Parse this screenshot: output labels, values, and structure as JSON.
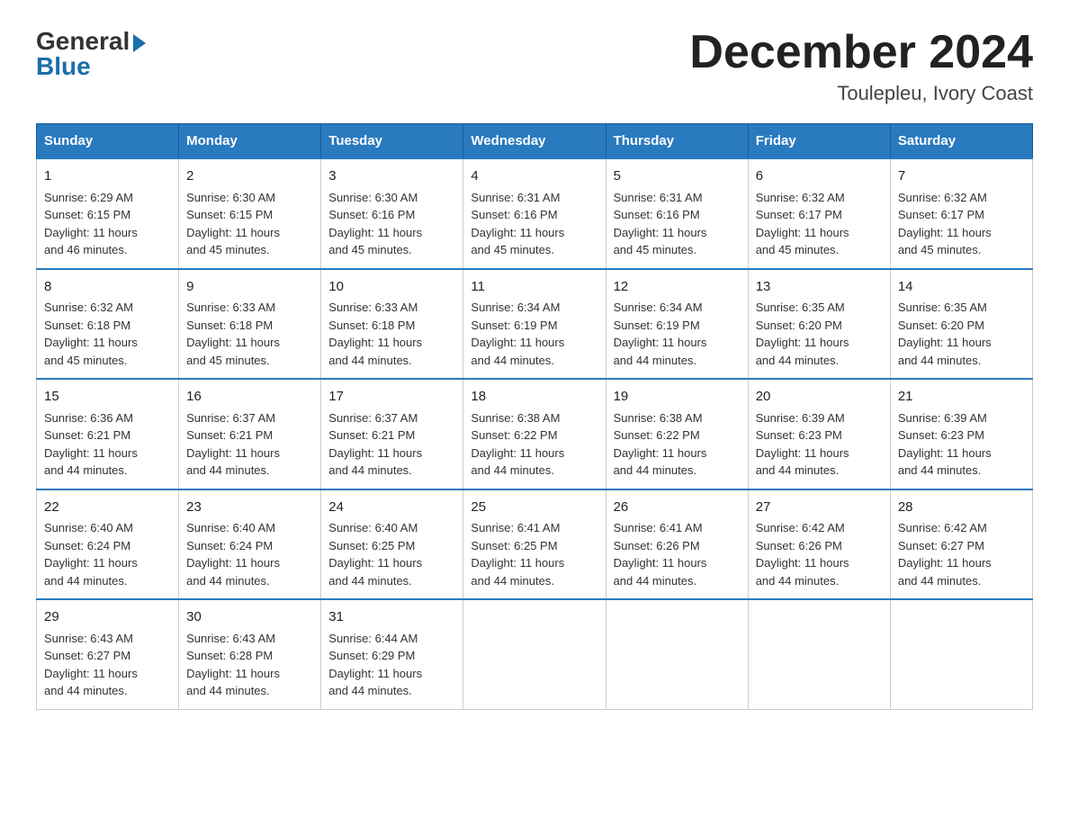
{
  "header": {
    "logo": {
      "general": "General",
      "blue": "Blue"
    },
    "title": "December 2024",
    "location": "Toulepleu, Ivory Coast"
  },
  "days_of_week": [
    "Sunday",
    "Monday",
    "Tuesday",
    "Wednesday",
    "Thursday",
    "Friday",
    "Saturday"
  ],
  "weeks": [
    [
      {
        "day": "1",
        "sunrise": "6:29 AM",
        "sunset": "6:15 PM",
        "daylight": "11 hours and 46 minutes."
      },
      {
        "day": "2",
        "sunrise": "6:30 AM",
        "sunset": "6:15 PM",
        "daylight": "11 hours and 45 minutes."
      },
      {
        "day": "3",
        "sunrise": "6:30 AM",
        "sunset": "6:16 PM",
        "daylight": "11 hours and 45 minutes."
      },
      {
        "day": "4",
        "sunrise": "6:31 AM",
        "sunset": "6:16 PM",
        "daylight": "11 hours and 45 minutes."
      },
      {
        "day": "5",
        "sunrise": "6:31 AM",
        "sunset": "6:16 PM",
        "daylight": "11 hours and 45 minutes."
      },
      {
        "day": "6",
        "sunrise": "6:32 AM",
        "sunset": "6:17 PM",
        "daylight": "11 hours and 45 minutes."
      },
      {
        "day": "7",
        "sunrise": "6:32 AM",
        "sunset": "6:17 PM",
        "daylight": "11 hours and 45 minutes."
      }
    ],
    [
      {
        "day": "8",
        "sunrise": "6:32 AM",
        "sunset": "6:18 PM",
        "daylight": "11 hours and 45 minutes."
      },
      {
        "day": "9",
        "sunrise": "6:33 AM",
        "sunset": "6:18 PM",
        "daylight": "11 hours and 45 minutes."
      },
      {
        "day": "10",
        "sunrise": "6:33 AM",
        "sunset": "6:18 PM",
        "daylight": "11 hours and 44 minutes."
      },
      {
        "day": "11",
        "sunrise": "6:34 AM",
        "sunset": "6:19 PM",
        "daylight": "11 hours and 44 minutes."
      },
      {
        "day": "12",
        "sunrise": "6:34 AM",
        "sunset": "6:19 PM",
        "daylight": "11 hours and 44 minutes."
      },
      {
        "day": "13",
        "sunrise": "6:35 AM",
        "sunset": "6:20 PM",
        "daylight": "11 hours and 44 minutes."
      },
      {
        "day": "14",
        "sunrise": "6:35 AM",
        "sunset": "6:20 PM",
        "daylight": "11 hours and 44 minutes."
      }
    ],
    [
      {
        "day": "15",
        "sunrise": "6:36 AM",
        "sunset": "6:21 PM",
        "daylight": "11 hours and 44 minutes."
      },
      {
        "day": "16",
        "sunrise": "6:37 AM",
        "sunset": "6:21 PM",
        "daylight": "11 hours and 44 minutes."
      },
      {
        "day": "17",
        "sunrise": "6:37 AM",
        "sunset": "6:21 PM",
        "daylight": "11 hours and 44 minutes."
      },
      {
        "day": "18",
        "sunrise": "6:38 AM",
        "sunset": "6:22 PM",
        "daylight": "11 hours and 44 minutes."
      },
      {
        "day": "19",
        "sunrise": "6:38 AM",
        "sunset": "6:22 PM",
        "daylight": "11 hours and 44 minutes."
      },
      {
        "day": "20",
        "sunrise": "6:39 AM",
        "sunset": "6:23 PM",
        "daylight": "11 hours and 44 minutes."
      },
      {
        "day": "21",
        "sunrise": "6:39 AM",
        "sunset": "6:23 PM",
        "daylight": "11 hours and 44 minutes."
      }
    ],
    [
      {
        "day": "22",
        "sunrise": "6:40 AM",
        "sunset": "6:24 PM",
        "daylight": "11 hours and 44 minutes."
      },
      {
        "day": "23",
        "sunrise": "6:40 AM",
        "sunset": "6:24 PM",
        "daylight": "11 hours and 44 minutes."
      },
      {
        "day": "24",
        "sunrise": "6:40 AM",
        "sunset": "6:25 PM",
        "daylight": "11 hours and 44 minutes."
      },
      {
        "day": "25",
        "sunrise": "6:41 AM",
        "sunset": "6:25 PM",
        "daylight": "11 hours and 44 minutes."
      },
      {
        "day": "26",
        "sunrise": "6:41 AM",
        "sunset": "6:26 PM",
        "daylight": "11 hours and 44 minutes."
      },
      {
        "day": "27",
        "sunrise": "6:42 AM",
        "sunset": "6:26 PM",
        "daylight": "11 hours and 44 minutes."
      },
      {
        "day": "28",
        "sunrise": "6:42 AM",
        "sunset": "6:27 PM",
        "daylight": "11 hours and 44 minutes."
      }
    ],
    [
      {
        "day": "29",
        "sunrise": "6:43 AM",
        "sunset": "6:27 PM",
        "daylight": "11 hours and 44 minutes."
      },
      {
        "day": "30",
        "sunrise": "6:43 AM",
        "sunset": "6:28 PM",
        "daylight": "11 hours and 44 minutes."
      },
      {
        "day": "31",
        "sunrise": "6:44 AM",
        "sunset": "6:29 PM",
        "daylight": "11 hours and 44 minutes."
      },
      null,
      null,
      null,
      null
    ]
  ],
  "labels": {
    "sunrise": "Sunrise:",
    "sunset": "Sunset:",
    "daylight": "Daylight:"
  }
}
